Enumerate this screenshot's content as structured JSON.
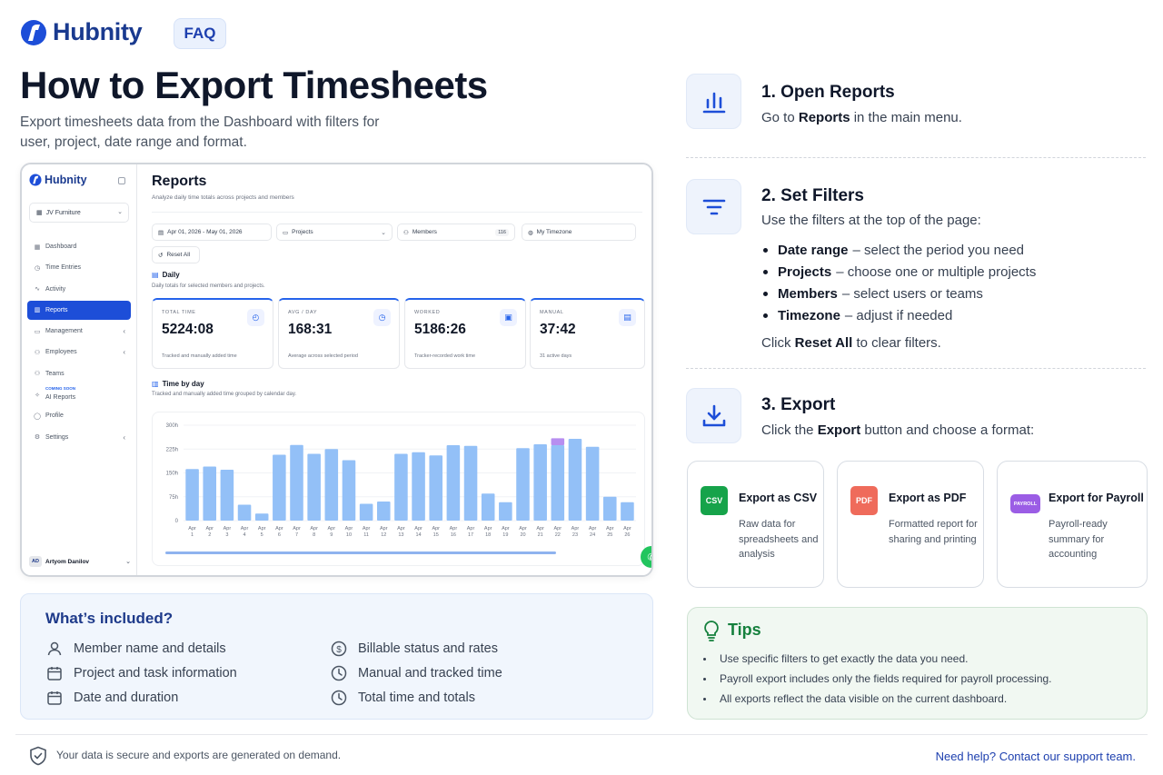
{
  "brand": {
    "name": "Hubnity",
    "faq_label": "FAQ"
  },
  "hero": {
    "title": "How to Export Timesheets",
    "subtitle": "Export timesheets data from the Dashboard with filters for user, project, date range and format."
  },
  "app": {
    "brand_name": "Hubnity",
    "workspace": "JV Furniture",
    "nav": [
      {
        "label": "Dashboard",
        "icon": "grid-icon"
      },
      {
        "label": "Time Entries",
        "icon": "clock-icon"
      },
      {
        "label": "Activity",
        "icon": "activity-icon"
      },
      {
        "label": "Reports",
        "icon": "chart-icon",
        "active": true
      },
      {
        "label": "Management",
        "icon": "folder-icon",
        "arrow": true
      },
      {
        "label": "Employees",
        "icon": "users-icon",
        "arrow": true
      },
      {
        "label": "Teams",
        "icon": "team-icon"
      },
      {
        "label": "AI Reports",
        "icon": "sparkle-icon",
        "soon": "COMING SOON"
      },
      {
        "label": "Profile",
        "icon": "user-icon"
      },
      {
        "label": "Settings",
        "icon": "gear-icon",
        "arrow": true
      }
    ],
    "user": {
      "initials": "AD",
      "name": "Artyom Danilov"
    },
    "page_title": "Reports",
    "page_sub": "Analyze daily time totals across projects and members",
    "filters": {
      "date_range": "Apr 01, 2026 - May 01, 2026",
      "projects": "Projects",
      "members": "Members",
      "members_count": "116",
      "timezone": "My Timezone",
      "reset": "Reset All"
    },
    "daily": {
      "title": "Daily",
      "sub": "Daily totals for selected members and projects."
    },
    "cards": [
      {
        "label": "TOTAL TIME",
        "value": "5224:08",
        "desc": "Tracked and manually added time",
        "icon": "timer-icon"
      },
      {
        "label": "AVG / DAY",
        "value": "168:31",
        "desc": "Average across selected period",
        "icon": "clock-icon"
      },
      {
        "label": "WORKED",
        "value": "5186:26",
        "desc": "Tracker-recorded work time",
        "icon": "briefcase-icon"
      },
      {
        "label": "MANUAL",
        "value": "37:42",
        "desc": "31 active days",
        "icon": "calendar-icon"
      }
    ],
    "time_by_day": {
      "title": "Time by day",
      "sub": "Tracked and manually added time grouped by calendar day."
    }
  },
  "chart_data": {
    "type": "bar",
    "title": "Time by day",
    "categories": [
      "Apr 1",
      "Apr 2",
      "Apr 3",
      "Apr 4",
      "Apr 5",
      "Apr 6",
      "Apr 7",
      "Apr 8",
      "Apr 9",
      "Apr 10",
      "Apr 11",
      "Apr 12",
      "Apr 13",
      "Apr 14",
      "Apr 15",
      "Apr 16",
      "Apr 17",
      "Apr 18",
      "Apr 19",
      "Apr 20",
      "Apr 21",
      "Apr 22",
      "Apr 23",
      "Apr 24",
      "Apr 25",
      "Apr 26"
    ],
    "tick_month": "Apr",
    "tick_days": [
      "1",
      "2",
      "3",
      "4",
      "5",
      "6",
      "7",
      "8",
      "9",
      "10",
      "11",
      "12",
      "13",
      "14",
      "15",
      "16",
      "17",
      "18",
      "19",
      "20",
      "21",
      "22",
      "23",
      "24",
      "25",
      "26"
    ],
    "series": [
      {
        "values": [
          162,
          170,
          160,
          50,
          22,
          207,
          238,
          210,
          225,
          190,
          53,
          60,
          210,
          215,
          205,
          237,
          235,
          85,
          58,
          228,
          240,
          237,
          257,
          232,
          75,
          58
        ],
        "color": "#93c0f7"
      },
      {
        "values": [
          0,
          0,
          0,
          0,
          0,
          0,
          0,
          0,
          0,
          0,
          0,
          0,
          0,
          0,
          0,
          0,
          0,
          0,
          0,
          0,
          0,
          22,
          0,
          0,
          0,
          0
        ],
        "color": "#b78ef0"
      }
    ],
    "y_ticks": [
      "0",
      "75h",
      "150h",
      "225h",
      "300h"
    ],
    "ylim": [
      0,
      300
    ],
    "xlabel": "",
    "ylabel": ""
  },
  "included": {
    "title": "What’s included?",
    "items": [
      {
        "label": "Member name and details",
        "icon": "user-icon"
      },
      {
        "label": "Project and task information",
        "icon": "calendar-icon"
      },
      {
        "label": "Date and duration",
        "icon": "calendar-icon"
      },
      {
        "label": "Billable status and rates",
        "icon": "dollar-icon"
      },
      {
        "label": "Manual and tracked time",
        "icon": "clock-icon"
      },
      {
        "label": "Total time and totals",
        "icon": "clock-icon"
      }
    ]
  },
  "steps": {
    "s1": {
      "title": "1. Open Reports",
      "pre": "Go to ",
      "bold": "Reports",
      "post": " in the main menu."
    },
    "s2": {
      "title": "2. Set Filters",
      "text": "Use the filters at the top of the page:",
      "bullets": [
        {
          "bold": "Date range",
          "text": "– select the period you need"
        },
        {
          "bold": "Projects",
          "text": "– choose one or multiple projects"
        },
        {
          "bold": "Members",
          "text": "– select users or teams"
        },
        {
          "bold": "Timezone",
          "text": "– adjust if needed"
        }
      ],
      "reset_pre": "Click ",
      "reset_bold": "Reset All",
      "reset_post": " to clear filters."
    },
    "s3": {
      "title": "3. Export",
      "pre": "Click the ",
      "bold": "Export",
      "post": " button and choose a format:"
    }
  },
  "formats": [
    {
      "badge": "CSV",
      "title": "Export as CSV",
      "desc": "Raw data for spreadsheets and analysis",
      "color": "#16a34a"
    },
    {
      "badge": "PDF",
      "title": "Export as PDF",
      "desc": "Formatted report for sharing and printing",
      "color": "#ef6b5b"
    },
    {
      "badge": "PAYROLL",
      "title": "Export for Payroll",
      "desc": "Payroll-ready summary for accounting",
      "color": "#9b5de5"
    }
  ],
  "tips": {
    "title": "Tips",
    "items": [
      "Use specific filters to get exactly the data you need.",
      "Payroll export includes only the fields required for payroll processing.",
      "All exports reflect the data visible on the current dashboard."
    ]
  },
  "footer": {
    "left": "Your data is secure and exports are generated on demand.",
    "right": "Need help? Contact our support team."
  }
}
